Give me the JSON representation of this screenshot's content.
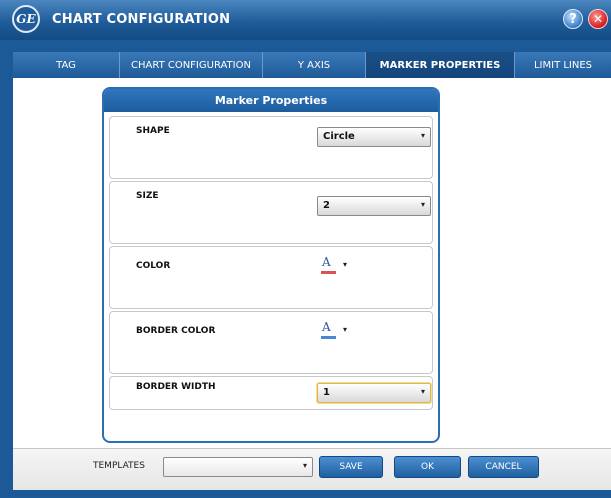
{
  "window": {
    "title": "CHART CONFIGURATION",
    "logo_text": "GE",
    "help_label": "?",
    "close_label": "✕"
  },
  "tabs": [
    {
      "label": "TAG",
      "active": false
    },
    {
      "label": "CHART CONFIGURATION",
      "active": false
    },
    {
      "label": "Y AXIS",
      "active": false
    },
    {
      "label": "MARKER PROPERTIES",
      "active": true
    },
    {
      "label": "LIMIT LINES",
      "active": false
    }
  ],
  "panel": {
    "title": "Marker Properties",
    "shape": {
      "label": "SHAPE",
      "value": "Circle"
    },
    "size": {
      "label": "SIZE",
      "value": "2"
    },
    "color": {
      "label": "COLOR",
      "glyph": "A",
      "swatch": "#d9534f"
    },
    "border_color": {
      "label": "BORDER COLOR",
      "glyph": "A",
      "swatch": "#4a86d8"
    },
    "border_width": {
      "label": "BORDER WIDTH",
      "value": "1"
    }
  },
  "footer": {
    "templates_label": "TEMPLATES",
    "templates_value": "",
    "save_label": "SAVE",
    "ok_label": "OK",
    "cancel_label": "CANCEL"
  },
  "icons": {
    "dropdown_arrow": "▾",
    "logo": "ge-logo-icon",
    "help": "help-icon",
    "close": "close-icon"
  },
  "colors": {
    "brand_blue": "#1f5c99",
    "active_tab": "#14457a",
    "focus_border": "#e0b84a"
  }
}
